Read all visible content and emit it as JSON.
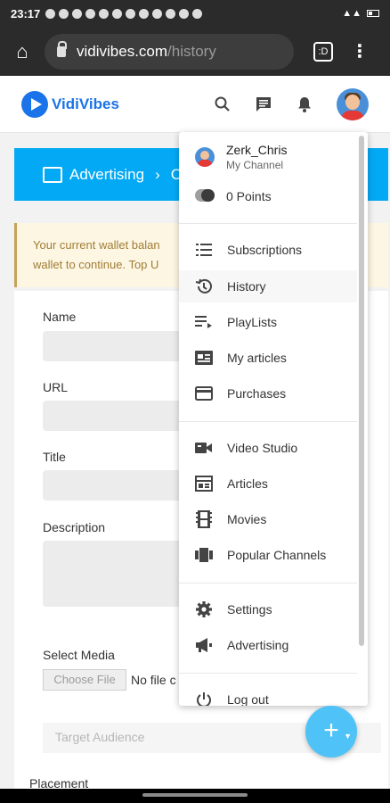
{
  "status_bar": {
    "time": "23:17"
  },
  "browser": {
    "url_host": "vidivibes.com",
    "url_path": "/history",
    "tab_count": ":D"
  },
  "site": {
    "logo_text": "VidiVibes"
  },
  "breadcrumb": {
    "section": "Advertising",
    "next": "C"
  },
  "alert": {
    "line1": "Your current wallet balan",
    "line2": "wallet to continue. Top U"
  },
  "form": {
    "name_label": "Name",
    "url_label": "URL",
    "title_label": "Title",
    "description_label": "Description",
    "media_label": "Select Media",
    "choose_file_button": "Choose File",
    "no_file_text": "No file c",
    "audience_placeholder": "Target Audience",
    "placement_label": "Placement"
  },
  "menu": {
    "username": "Zerk_Chris",
    "channel_label": "My Channel",
    "points": "0 Points",
    "items": [
      {
        "label": "Subscriptions",
        "icon": "subscriptions-icon"
      },
      {
        "label": "History",
        "icon": "history-icon"
      },
      {
        "label": "PlayLists",
        "icon": "playlist-icon"
      },
      {
        "label": "My articles",
        "icon": "articles-card-icon"
      },
      {
        "label": "Purchases",
        "icon": "credit-card-icon"
      },
      {
        "label": "Video Studio",
        "icon": "video-studio-icon"
      },
      {
        "label": "Articles",
        "icon": "articles-icon"
      },
      {
        "label": "Movies",
        "icon": "movies-icon"
      },
      {
        "label": "Popular Channels",
        "icon": "channels-icon"
      },
      {
        "label": "Settings",
        "icon": "gear-icon"
      },
      {
        "label": "Advertising",
        "icon": "megaphone-icon"
      },
      {
        "label": "Log out",
        "icon": "power-icon"
      }
    ]
  },
  "fab": {
    "label": "+"
  },
  "colors": {
    "brand": "#1a73e8",
    "banner": "#03a9f4",
    "fab": "#4fc3f7",
    "alert_text": "#a07d35"
  }
}
